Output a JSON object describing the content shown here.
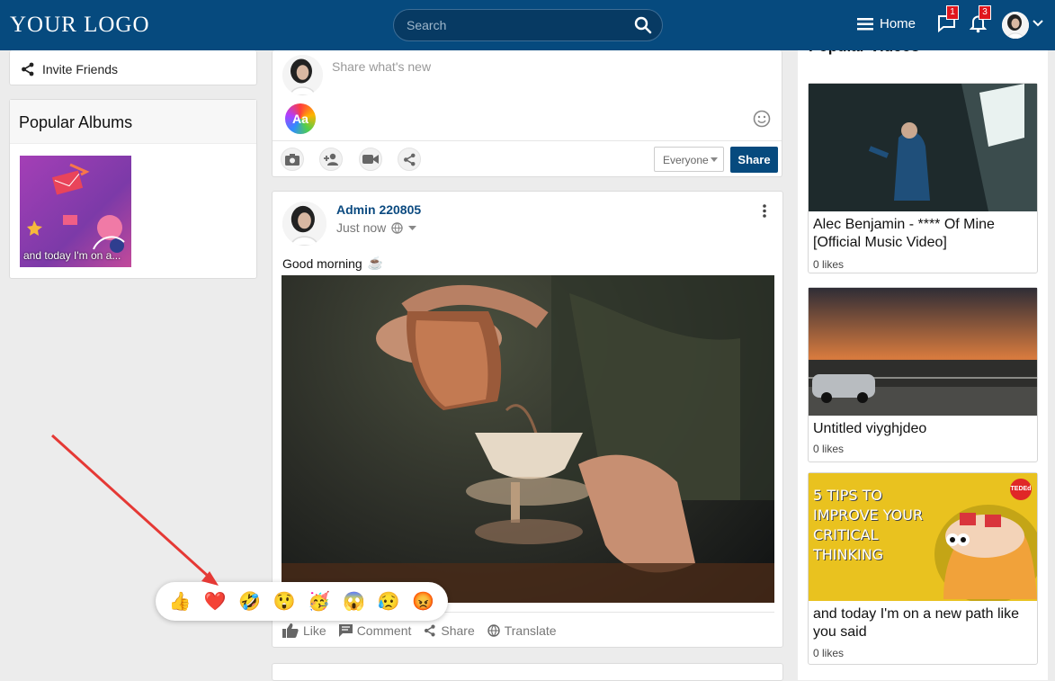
{
  "header": {
    "logo": "YOUR LOGO",
    "search_placeholder": "Search",
    "home_label": "Home",
    "messages_badge": "1",
    "notifications_badge": "3"
  },
  "left": {
    "invite_label": "Invite Friends",
    "albums_title": "Popular Albums",
    "album_caption": "and today I'm on a..."
  },
  "composer": {
    "placeholder": "Share what's new",
    "aa": "Aa",
    "audience": "Everyone",
    "share_label": "Share"
  },
  "post": {
    "author": "Admin 220805",
    "time": "Just now",
    "text": "Good morning",
    "text_emoji": "☕",
    "actions": {
      "like": "Like",
      "comment": "Comment",
      "share": "Share",
      "translate": "Translate"
    }
  },
  "reactions": [
    "👍",
    "❤️",
    "🤣",
    "😲",
    "🥳",
    "😱",
    "😥",
    "😡"
  ],
  "right": {
    "title": "Popular Videos",
    "videos": [
      {
        "title": "Alec Benjamin - **** Of Mine [Official Music Video]",
        "likes": "0 likes"
      },
      {
        "title": "Untitled viyghjdeo",
        "likes": "0 likes"
      },
      {
        "title": "and today I'm on a new path like you said",
        "likes": "0 likes",
        "thumb_text": "5 TIPS TO IMPROVE YOUR CRITICAL THINKING",
        "badge": "TEDEd"
      }
    ]
  },
  "colors": {
    "header": "#064a7e",
    "accent": "#0b4a80",
    "arrow": "#e53935"
  }
}
